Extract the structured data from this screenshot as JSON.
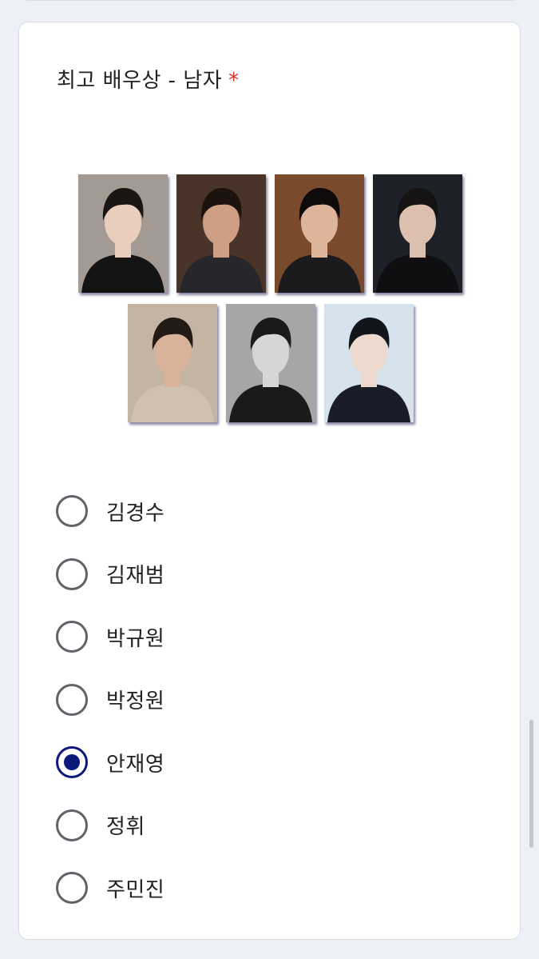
{
  "question": {
    "title": "최고 배우상 - 남자",
    "required_marker": "*"
  },
  "photos": [
    {
      "icon": "actor-photo",
      "bg": "#a49a94",
      "hair": "#1b1614",
      "skin": "#e9cdbd",
      "clothes": "#141414"
    },
    {
      "icon": "actor-photo",
      "bg": "#4a3328",
      "hair": "#1c130f",
      "skin": "#cf9f85",
      "clothes": "#26262b"
    },
    {
      "icon": "actor-photo",
      "bg": "#7a4a2c",
      "hair": "#0e0b0a",
      "skin": "#deb59b",
      "clothes": "#1b1b1e"
    },
    {
      "icon": "actor-photo",
      "bg": "#1f2129",
      "hair": "#151313",
      "skin": "#dcbfae",
      "clothes": "#0f0f12"
    },
    {
      "icon": "actor-photo",
      "bg": "#c4b4a3",
      "hair": "#231a15",
      "skin": "#d9b399",
      "clothes": "#cfc1b2"
    },
    {
      "icon": "actor-photo",
      "bg": "#a6a6a6",
      "hair": "#1a1a1a",
      "skin": "#d6d6d6",
      "clothes": "#1a1a1a"
    },
    {
      "icon": "actor-photo",
      "bg": "#d6e2ec",
      "hair": "#12151c",
      "skin": "#ecd8cd",
      "clothes": "#1a1d28"
    }
  ],
  "options": [
    {
      "label": "김경수",
      "selected": false
    },
    {
      "label": "김재범",
      "selected": false
    },
    {
      "label": "박규원",
      "selected": false
    },
    {
      "label": "박정원",
      "selected": false
    },
    {
      "label": "안재영",
      "selected": true
    },
    {
      "label": "정휘",
      "selected": false
    },
    {
      "label": "주민진",
      "selected": false
    }
  ],
  "colors": {
    "accent": "#0b1a7a",
    "required": "#d93025",
    "unselected_radio": "#5f6368"
  }
}
